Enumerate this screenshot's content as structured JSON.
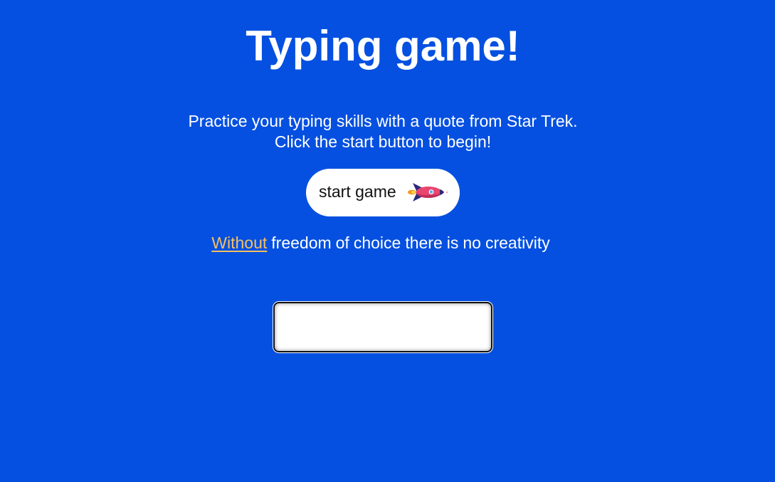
{
  "page": {
    "title": "Typing game!",
    "background_color": "#0550e0"
  },
  "intro": {
    "line1": "Practice your typing skills with a quote from Star Trek.",
    "line2": "Click the start button to begin!"
  },
  "start_button": {
    "label": "start game",
    "icon": "rocket-icon"
  },
  "quote": {
    "words": [
      "Without",
      "freedom",
      "of",
      "choice",
      "there",
      "is",
      "no",
      "creativity"
    ],
    "highlighted_index": 0,
    "highlight_color": "#f5c063"
  },
  "typed_input": {
    "value": "",
    "placeholder": ""
  }
}
